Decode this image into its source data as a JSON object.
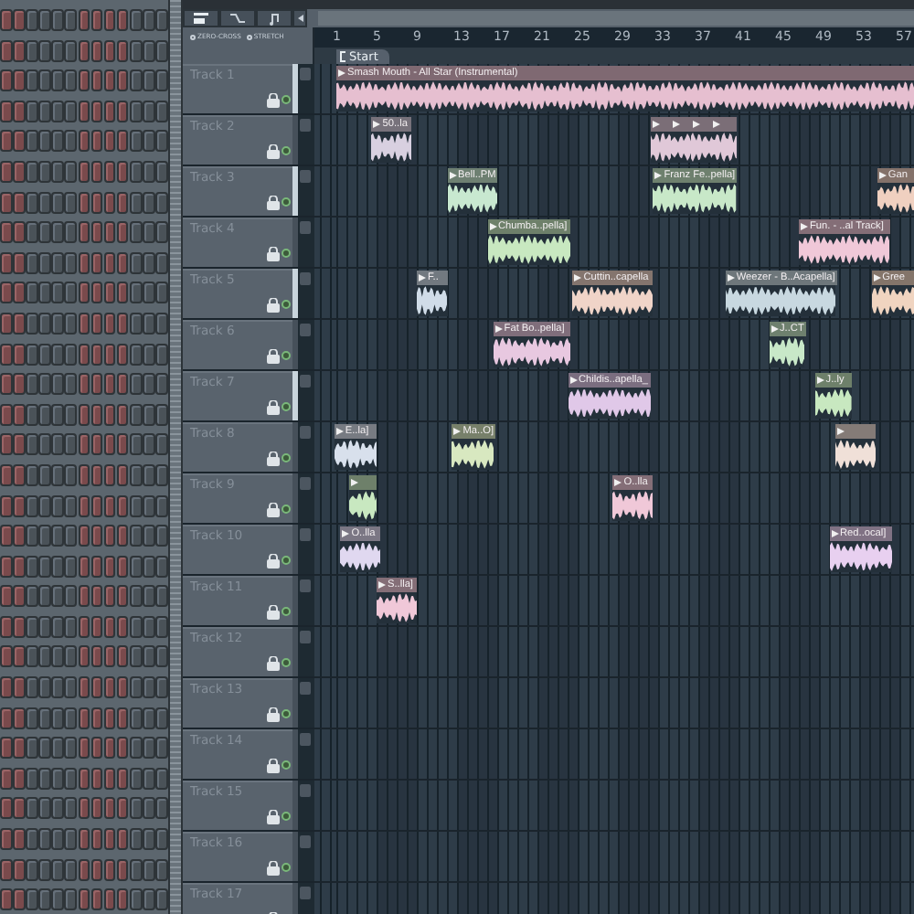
{
  "toolbar": {
    "options": [
      "ZERO-CROSS",
      "STRETCH"
    ]
  },
  "ruler": {
    "bars": [
      "1",
      "5",
      "9",
      "13",
      "17",
      "21",
      "25",
      "29",
      "33",
      "37",
      "41",
      "45",
      "49",
      "53",
      "57"
    ]
  },
  "marker": {
    "label": "Start"
  },
  "tracks": [
    {
      "name": "Track 1",
      "selected": true,
      "clips": [
        {
          "label": "Smash Mouth - All Star (Instrumental)",
          "color": "#e6bfd0"
        }
      ]
    },
    {
      "name": "Track 2",
      "selected": false,
      "clips": [
        {
          "label": "50..la",
          "color": "#d8d0e0"
        },
        {
          "color": "#e0c8d8"
        },
        {
          "color": "#e0c8d8"
        },
        {
          "color": "#e0c8d8"
        },
        {
          "color": "#e0c8d8"
        }
      ]
    },
    {
      "name": "Track 3",
      "selected": true,
      "clips": [
        {
          "label": "Bell..PM",
          "color": "#c8e8d0"
        },
        {
          "label": "Franz Fe..pella]",
          "color": "#c8e8c8"
        },
        {
          "label": "Gan",
          "color": "#f0d0c0"
        }
      ]
    },
    {
      "name": "Track 4",
      "selected": false,
      "clips": [
        {
          "label": "Chumba..pella]",
          "color": "#c8e8c0"
        },
        {
          "label": "Fun. - ..al Track]",
          "color": "#f0c8d8"
        }
      ]
    },
    {
      "name": "Track 5",
      "selected": true,
      "clips": [
        {
          "label": "F..",
          "color": "#d0dce8"
        },
        {
          "label": "Cuttin..capella",
          "color": "#f0d4c8"
        },
        {
          "label": "Weezer - B..Acapella]",
          "color": "#c8d8e0"
        },
        {
          "label": "Gree",
          "color": "#f0d4c0"
        }
      ]
    },
    {
      "name": "Track 6",
      "selected": false,
      "clips": [
        {
          "label": "Fat Bo..pella]",
          "color": "#e8c8e0"
        },
        {
          "label": "J..CT",
          "color": "#c8e8c8"
        }
      ]
    },
    {
      "name": "Track 7",
      "selected": true,
      "clips": [
        {
          "label": "Childis..apella_",
          "color": "#e0c8e8"
        },
        {
          "label": "J..ly",
          "color": "#c8e8c0"
        }
      ]
    },
    {
      "name": "Track 8",
      "selected": false,
      "clips": [
        {
          "label": "E..la]",
          "color": "#d8e0ec"
        },
        {
          "label": "Ma..O]",
          "color": "#d8e8c0"
        },
        {
          "color": "#f0e0d8"
        }
      ]
    },
    {
      "name": "Track 9",
      "selected": false,
      "clips": [
        {
          "color": "#c8e8c0"
        },
        {
          "label": "O..lla",
          "color": "#f0c8d8"
        }
      ]
    },
    {
      "name": "Track 10",
      "selected": false,
      "clips": [
        {
          "label": "O..lla",
          "color": "#e0d8f0"
        },
        {
          "label": "Red..ocal]",
          "color": "#e8d0f0"
        }
      ]
    },
    {
      "name": "Track 11",
      "selected": false,
      "clips": [
        {
          "label": "S..lla]",
          "color": "#f0c8d8"
        }
      ]
    },
    {
      "name": "Track 12",
      "selected": false
    },
    {
      "name": "Track 13",
      "selected": false
    },
    {
      "name": "Track 14",
      "selected": false
    },
    {
      "name": "Track 15",
      "selected": false
    },
    {
      "name": "Track 16",
      "selected": false
    },
    {
      "name": "Track 17",
      "selected": false
    }
  ]
}
